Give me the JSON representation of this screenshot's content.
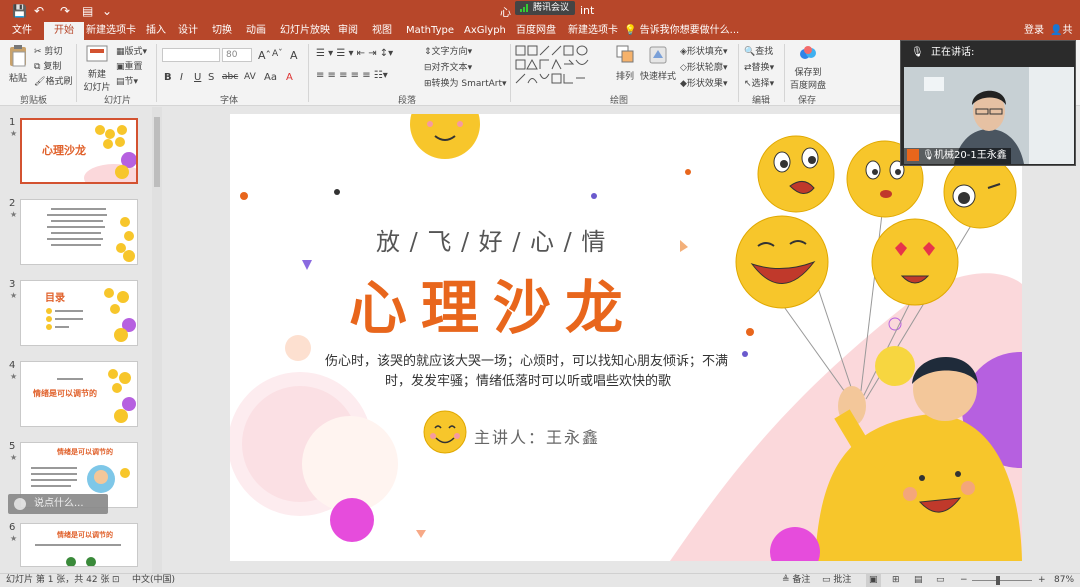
{
  "titlebar": {
    "doc_title_left": "心",
    "doc_title_right": "int",
    "meeting_badge": "腾讯会议"
  },
  "tabs": {
    "items": [
      {
        "label": "文件"
      },
      {
        "label": "开始"
      },
      {
        "label": "新建选项卡"
      },
      {
        "label": "插入"
      },
      {
        "label": "设计"
      },
      {
        "label": "切换"
      },
      {
        "label": "动画"
      },
      {
        "label": "幻灯片放映"
      },
      {
        "label": "审阅"
      },
      {
        "label": "视图"
      },
      {
        "label": "MathType"
      },
      {
        "label": "AxGlyph"
      },
      {
        "label": "百度网盘"
      },
      {
        "label": "新建选项卡"
      }
    ],
    "tell_me": "告诉我你想要做什么...",
    "login": "登录",
    "share": "共享"
  },
  "ribbon": {
    "clipboard": {
      "paste": "粘贴",
      "cut": "剪切",
      "copy": "复制",
      "format_painter": "格式刷",
      "label": "剪贴板"
    },
    "slides": {
      "new_slide": "新建",
      "new_slide2": "幻灯片",
      "layout": "版式",
      "reset": "重置",
      "section": "节",
      "label": "幻灯片"
    },
    "font": {
      "font_size": "80",
      "bold": "B",
      "italic": "I",
      "underline": "U",
      "shadow": "S",
      "strike": "abc",
      "spacing": "AV",
      "case": "Aa",
      "color": "A",
      "grow": "A",
      "shrink": "A",
      "clear": "A",
      "label": "字体"
    },
    "paragraph": {
      "text_direction": "文字方向",
      "align_text": "对齐文本",
      "smartart": "转换为 SmartArt",
      "label": "段落"
    },
    "drawing": {
      "arrange": "排列",
      "quick_styles": "快速样式",
      "shape_fill": "形状填充",
      "shape_outline": "形状轮廓",
      "shape_effects": "形状效果",
      "label": "绘图"
    },
    "editing": {
      "find": "查找",
      "replace": "替换",
      "select": "选择",
      "label": "编辑"
    },
    "save": {
      "save_to": "保存到",
      "baidu": "百度网盘",
      "label": "保存"
    }
  },
  "thumbnails": [
    {
      "num": "1",
      "title": "心理沙龙"
    },
    {
      "num": "2",
      "title": ""
    },
    {
      "num": "3",
      "title": "目录"
    },
    {
      "num": "4",
      "title": "情绪是可以调节的"
    },
    {
      "num": "5",
      "title": "情绪是可以调节的"
    },
    {
      "num": "6",
      "title": "情绪是可以调节的"
    }
  ],
  "pinyin_hint": "说点什么...",
  "slide": {
    "subtitle": "放 / 飞 / 好 / 心 / 情",
    "title": "心理沙龙",
    "desc_line1": "伤心时，该哭的就应该大哭一场；心烦时，可以找知心朋友倾诉；不满",
    "desc_line2": "时，发发牢骚；情绪低落时可以听或唱些欢快的歌",
    "speaker": "主讲人：王永鑫"
  },
  "video": {
    "speaking_label": "正在讲话:",
    "participant_name": "机械20-1王永鑫"
  },
  "status": {
    "slide_info": "幻灯片 第 1 张，共 42 张",
    "language": "中文(中国)",
    "notes": "备注",
    "comments": "批注",
    "zoom": "87%"
  },
  "colors": {
    "accent": "#b7472a",
    "title_orange": "#e8661c",
    "emoji_yellow": "#f7c62b",
    "purple": "#b660e0",
    "pink": "#f9d6d9"
  }
}
